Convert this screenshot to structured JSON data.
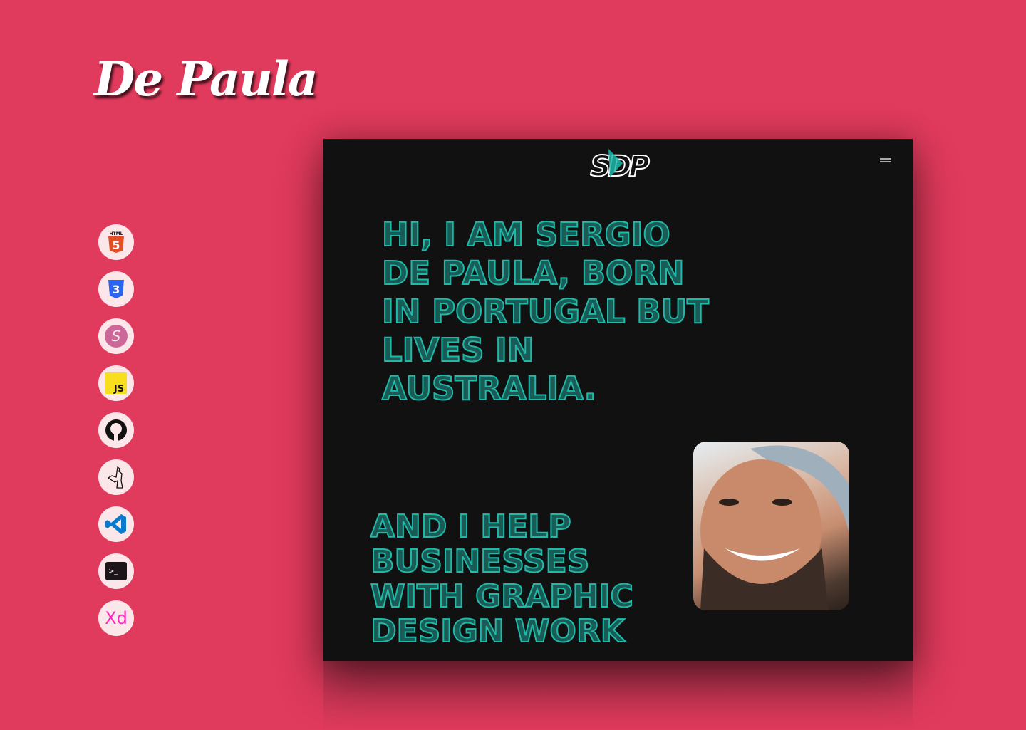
{
  "brand": {
    "title": "De Paula"
  },
  "sidebar": {
    "icons": [
      {
        "name": "html5-icon",
        "label": "HTML",
        "glyph": "5"
      },
      {
        "name": "css3-icon",
        "glyph": "3"
      },
      {
        "name": "sass-icon",
        "glyph": "S"
      },
      {
        "name": "javascript-icon",
        "glyph": "JS"
      },
      {
        "name": "github-icon"
      },
      {
        "name": "superhero-icon"
      },
      {
        "name": "vscode-icon"
      },
      {
        "name": "terminal-icon",
        "glyph": ">_"
      },
      {
        "name": "adobe-xd-icon",
        "glyph": "Xd"
      }
    ]
  },
  "card": {
    "logo": "SDP",
    "intro": "Hi, I am Sergio De Paula, born in Portugal but lives in Australia.",
    "help": "And I help businesses with graphic design work"
  },
  "colors": {
    "background": "#e03a5c",
    "card": "#111111",
    "accent": "#1fb9aa"
  }
}
